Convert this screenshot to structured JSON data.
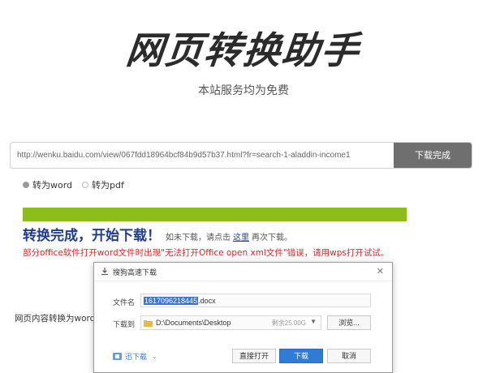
{
  "header": {
    "title": "网页转换助手",
    "subtitle": "本站服务均为免费"
  },
  "url_form": {
    "value": "http://wenku.baidu.com/view/067fdd18964bcf84b9d57b37.html?fr=search-1-aladdin-income1",
    "button_label": "下载完成"
  },
  "modes": [
    {
      "label": "转为word",
      "selected": true
    },
    {
      "label": "转为pdf",
      "selected": false
    }
  ],
  "progress": {
    "percent": 100,
    "color": "#8dbd1a"
  },
  "result": {
    "headline": "转换完成，开始下载！",
    "hint_before": "如未下载，请点击",
    "hint_link": "这里",
    "hint_after": "再次下载。",
    "warning": "部分office软件打开word文件时出现\"无法打开Office open xml文件\"错误，请用wps打开试试。"
  },
  "page_text": "网页内容转换为word",
  "dialog": {
    "title": "搜狗高速下载",
    "close": "✕",
    "filename_label": "文件名",
    "filename_selected": "1617096218445",
    "filename_ext": ".docx",
    "path_label": "下载到",
    "path_value": "D:\\Documents\\Desktop",
    "free_space": "剩余25.00G",
    "browse_label": "浏览...",
    "link_label": "迅下载",
    "open_label": "直接打开",
    "download_label": "下载",
    "cancel_label": "取消"
  },
  "colors": {
    "accent_blue": "#1f3c8f",
    "warning_red": "#d32a2a",
    "button_gray": "#6f6f6f"
  }
}
